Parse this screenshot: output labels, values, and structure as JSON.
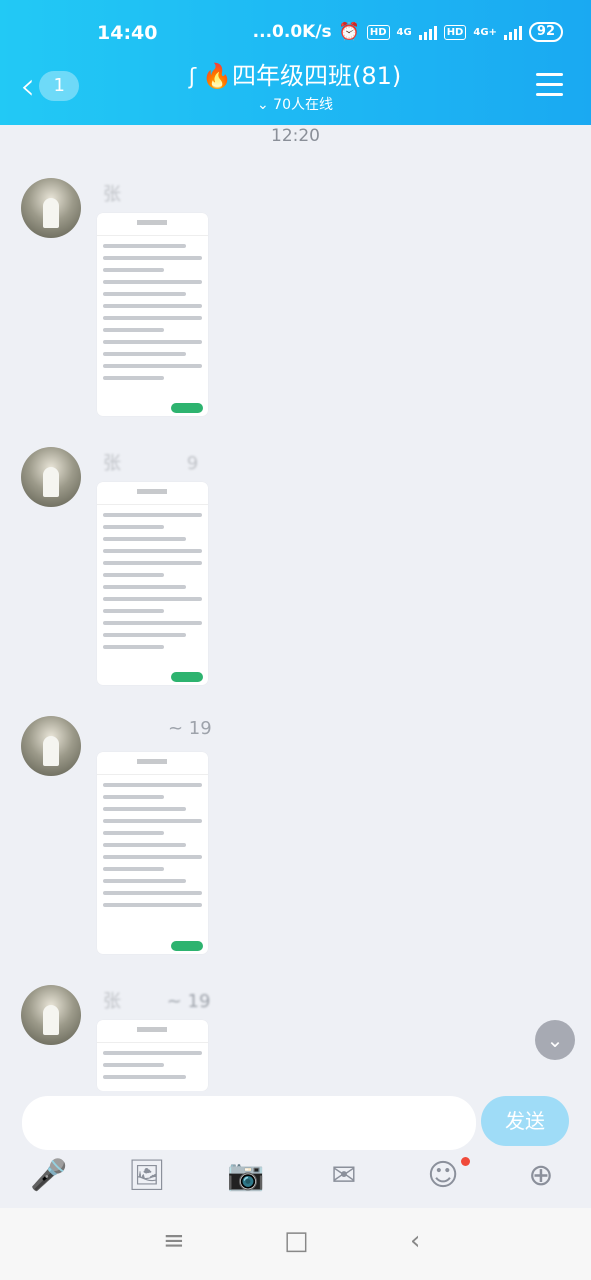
{
  "status_bar": {
    "time": "14:40",
    "network_speed": "...0.0K/s",
    "hd1": "HD",
    "net1": "4G",
    "hd2": "HD",
    "net2": "4G+",
    "battery": "92",
    "icons": [
      "alarm-icon",
      "signal-icon",
      "battery-icon"
    ]
  },
  "nav": {
    "back_badge": "1",
    "title": "四年级四班(81)",
    "online": "70人在线",
    "title_emoji": "🔥"
  },
  "chat": {
    "timestamp": "12:20",
    "messages": [
      {
        "sender": "张",
        "suffix": "",
        "image": "screenshot"
      },
      {
        "sender": "张",
        "suffix": "9",
        "image": "screenshot"
      },
      {
        "sender": "",
        "suffix": "~ 19",
        "image": "screenshot"
      },
      {
        "sender": "张",
        "suffix": "~ 19",
        "image": "screenshot"
      }
    ]
  },
  "composer": {
    "send_label": "发送",
    "input_value": ""
  },
  "toolbar": {
    "items": [
      "mic-icon",
      "image-icon",
      "camera-icon",
      "red-packet-icon",
      "emoji-icon",
      "plus-icon"
    ]
  },
  "colors": {
    "header_start": "#22c9f5",
    "header_end": "#1aa9f2",
    "send_disabled": "#9fdcf7",
    "badge_red": "#f04a3a"
  }
}
